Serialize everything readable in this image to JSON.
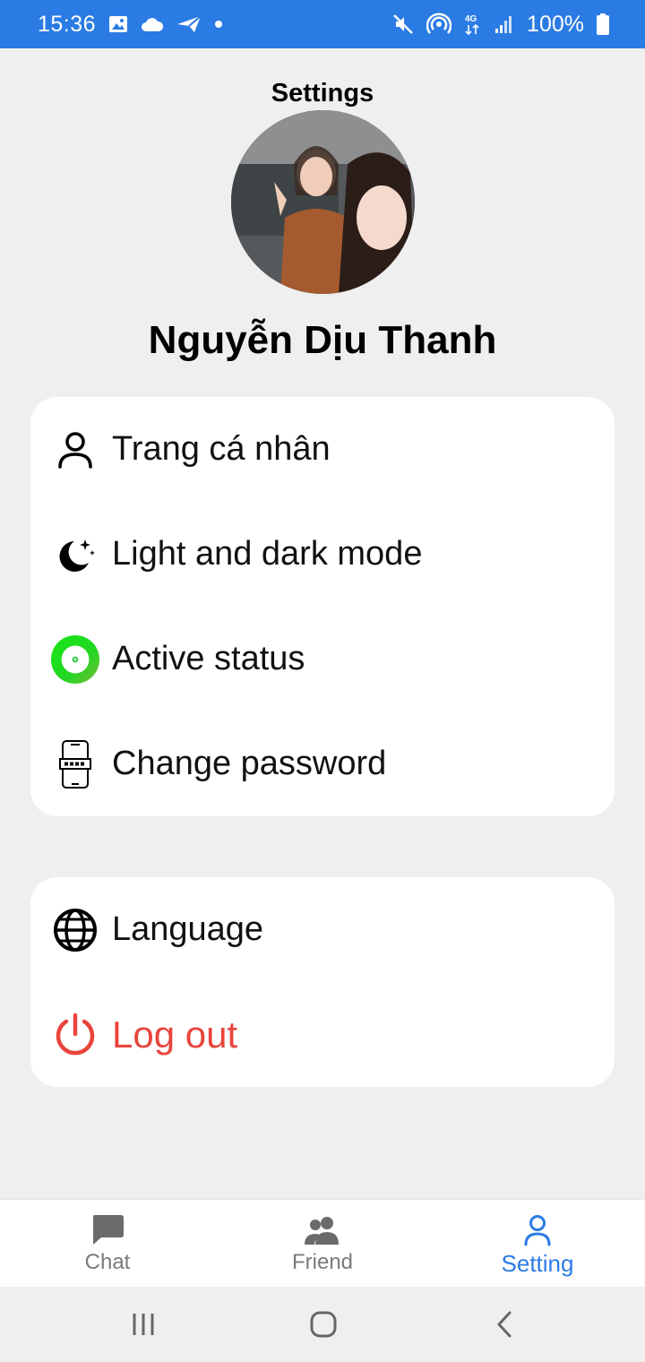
{
  "status_bar": {
    "time": "15:36",
    "battery": "100%",
    "network": "4G",
    "background_color": "#2b7be4"
  },
  "header": {
    "title": "Settings",
    "user_name": "Nguyễn Dịu Thanh"
  },
  "menu_primary": [
    {
      "label": "Trang cá nhân",
      "icon": "person-icon"
    },
    {
      "label": "Light and dark mode",
      "icon": "moon-stars-icon"
    },
    {
      "label": "Active status",
      "icon": "active-status-icon"
    },
    {
      "label": "Change password",
      "icon": "phone-password-icon"
    }
  ],
  "menu_secondary": [
    {
      "label": "Language",
      "icon": "globe-icon"
    },
    {
      "label": "Log out",
      "icon": "power-icon",
      "color": "#e8453c"
    }
  ],
  "bottom_nav": [
    {
      "label": "Chat",
      "icon": "chat-bubble-icon",
      "active": false
    },
    {
      "label": "Friend",
      "icon": "people-icon",
      "active": false
    },
    {
      "label": "Setting",
      "icon": "person-outline-icon",
      "active": true
    }
  ],
  "colors": {
    "accent": "#2b7be4",
    "danger": "#e8453c",
    "active_green": "#22dd22",
    "background": "#efefef"
  }
}
